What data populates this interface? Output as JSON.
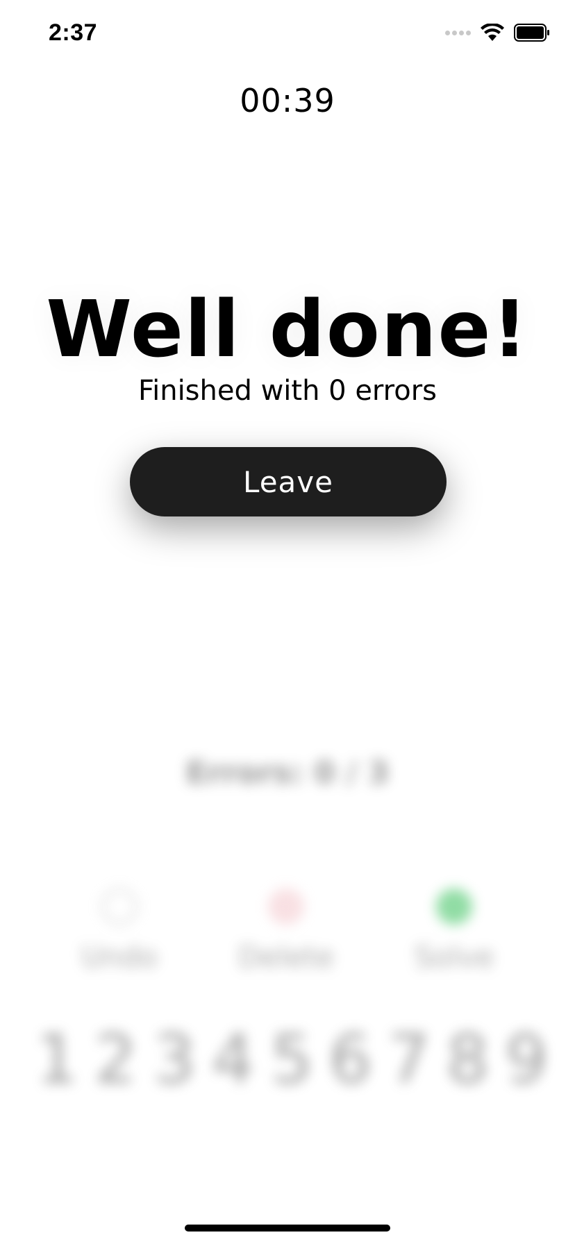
{
  "status_bar": {
    "time": "2:37",
    "icons": [
      "signal-icon",
      "wifi-icon",
      "battery-icon"
    ]
  },
  "timer": "00:39",
  "dialog": {
    "title": "Well done!",
    "subtitle": "Finished with 0 errors",
    "leave_label": "Leave"
  },
  "background": {
    "errors": "Errors: 0 / 3",
    "controls": [
      {
        "label": "Undo",
        "icon": "undo-icon"
      },
      {
        "label": "Delete",
        "icon": "delete-icon"
      },
      {
        "label": "Solve",
        "icon": "solve-icon"
      }
    ],
    "numbers": [
      "1",
      "2",
      "3",
      "4",
      "5",
      "6",
      "7",
      "8",
      "9"
    ]
  },
  "colors": {
    "button_bg": "#1e1e1e",
    "solve_green": "#36c05a",
    "delete_pink": "#f3c7cc"
  }
}
